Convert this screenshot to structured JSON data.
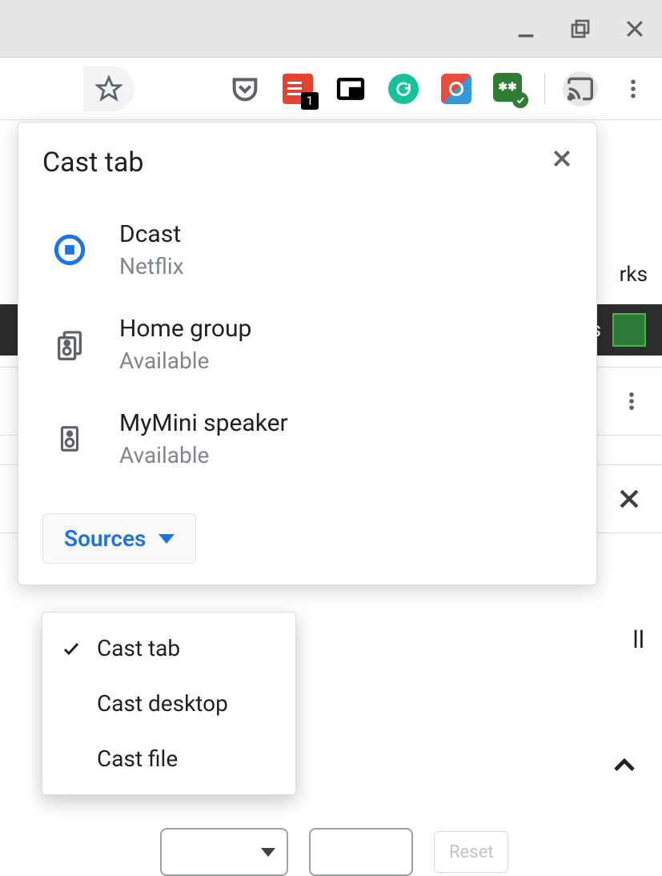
{
  "window": {
    "controls": [
      "minimize",
      "maximize",
      "close"
    ]
  },
  "toolbar": {
    "star": "bookmark-star",
    "extensions": [
      {
        "name": "pocket"
      },
      {
        "name": "todoist",
        "badge": "1"
      },
      {
        "name": "pip"
      },
      {
        "name": "grammarly"
      },
      {
        "name": "shazam"
      },
      {
        "name": "pass"
      }
    ],
    "cast_active": true
  },
  "cast": {
    "title": "Cast tab",
    "devices": [
      {
        "name": "Dcast",
        "status": "Netflix",
        "icon": "stop",
        "active": true
      },
      {
        "name": "Home group",
        "status": "Available",
        "icon": "group",
        "active": false
      },
      {
        "name": "MyMini speaker",
        "status": "Available",
        "icon": "speaker",
        "active": false
      }
    ],
    "sources_label": "Sources",
    "sources_menu": [
      {
        "label": "Cast tab",
        "checked": true
      },
      {
        "label": "Cast desktop",
        "checked": false
      },
      {
        "label": "Cast file",
        "checked": false
      }
    ]
  },
  "background": {
    "bookmarks_fragment": "rks",
    "darkbar_fragment": "is",
    "text_fragment": "ll",
    "reset_label": "Reset"
  }
}
